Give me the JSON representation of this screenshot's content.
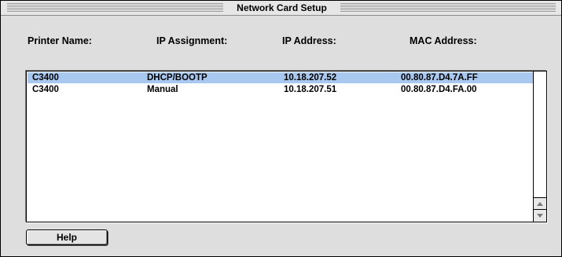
{
  "window": {
    "title": "Network Card Setup"
  },
  "columns": {
    "printer_name": "Printer Name:",
    "ip_assignment": "IP Assignment:",
    "ip_address": "IP Address:",
    "mac_address": "MAC Address:"
  },
  "rows": [
    {
      "printer": "C3400",
      "assignment": "DHCP/BOOTP",
      "ip": "10.18.207.52",
      "mac": "00.80.87.D4.7A.FF",
      "selected": true
    },
    {
      "printer": "C3400",
      "assignment": "Manual",
      "ip": "10.18.207.51",
      "mac": "00.80.87.D4.FA.00",
      "selected": false
    }
  ],
  "buttons": {
    "help": "Help"
  },
  "icons": {
    "scroll_up": "scroll-up-arrow-icon",
    "scroll_down": "scroll-down-arrow-icon"
  },
  "colors": {
    "selection": "#a8c8f0",
    "window_bg": "#dedede"
  }
}
